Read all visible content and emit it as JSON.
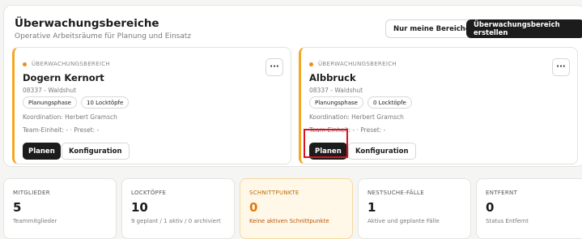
{
  "header": {
    "title": "Überwachungsbereiche",
    "subtitle": "Operative Arbeitsräume für Planung und Einsatz",
    "my_areas_label": "Nur meine Bereiche",
    "create_label": "Überwachungsbereich erstellen"
  },
  "cards": [
    {
      "eyebrow": "ÜBERWACHUNGSBEREICH",
      "more": "···",
      "title": "Dogern Kernort",
      "location": "08337 - Waldshut",
      "tags": [
        "Planungsphase",
        "10 Locktöpfe"
      ],
      "coordination": "Koordination: Herbert Gramsch",
      "team": "Team-Einheit: - · Preset: -",
      "plan_label": "Planen",
      "config_label": "Konfiguration"
    },
    {
      "eyebrow": "ÜBERWACHUNGSBEREICH",
      "more": "···",
      "title": "Albbruck",
      "location": "08337 - Waldshut",
      "tags": [
        "Planungsphase",
        "0 Locktöpfe"
      ],
      "coordination": "Koordination: Herbert Gramsch",
      "team": "Team-Einheit: - · Preset: -",
      "plan_label": "Planen",
      "config_label": "Konfiguration"
    }
  ],
  "stats": [
    {
      "label": "MITGLIEDER",
      "value": "5",
      "sub": "Teammitglieder"
    },
    {
      "label": "LOCKTÖPFE",
      "value": "10",
      "sub": "9 geplant / 1 aktiv / 0 archiviert"
    },
    {
      "label": "SCHNITTPUNKTE",
      "value": "0",
      "sub": "Keine aktiven Schnittpunkte"
    },
    {
      "label": "NESTSUCHE-FÄLLE",
      "value": "1",
      "sub": "Aktive und geplante Fälle"
    },
    {
      "label": "ENTFERNT",
      "value": "0",
      "sub": "Status Entfernt"
    }
  ]
}
